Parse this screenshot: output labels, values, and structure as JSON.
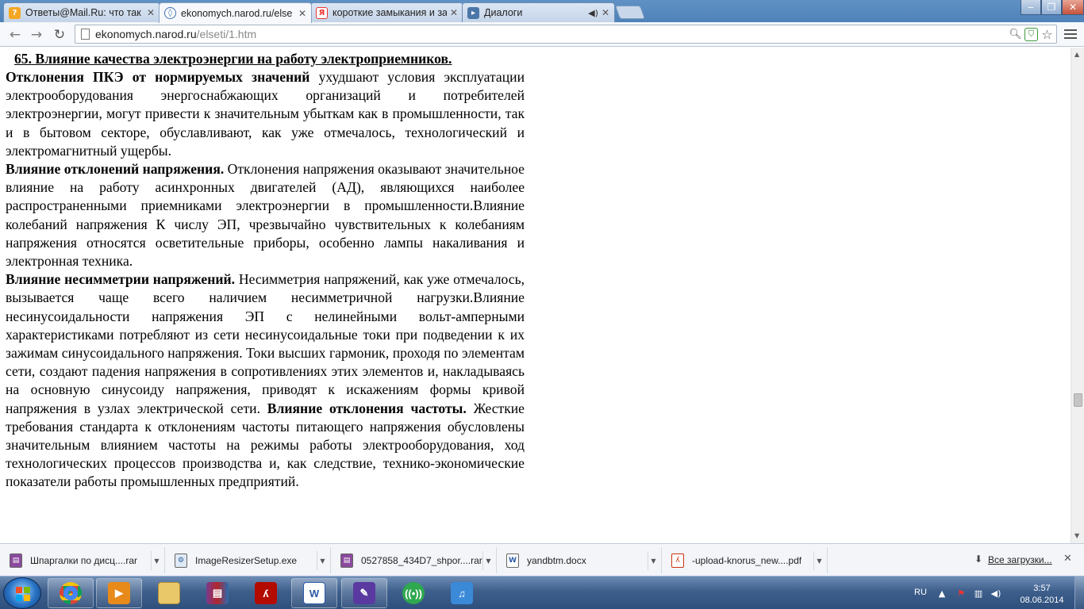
{
  "browser": {
    "tabs": [
      {
        "title": "Ответы@Mail.Ru: что так",
        "icon": "mail-ru-answers-icon"
      },
      {
        "title": "ekonomych.narod.ru/else",
        "icon": "narod-icon"
      },
      {
        "title": "короткие замыкания и за",
        "icon": "yandex-icon"
      },
      {
        "title": "Диалоги",
        "icon": "dialogs-icon"
      }
    ],
    "url_host": "ekonomych.narod.ru",
    "url_path": "/elseti/1.htm"
  },
  "article": {
    "heading": "65. Влияние качества электроэнергии на работу электроприемников.",
    "p1_bold": "Отклонения ПКЭ от нормируемых значений",
    "p1_text": " ухудшают условия эксплуатации электрооборудования энергоснабжающих организаций и потребителей электроэнергии, могут привести к значительным убыткам как в промышленности, так и в бытовом секторе, обуславливают, как уже отмечалось, технологический и электромагнитный ущербы.",
    "p2_bold": "Влияние отклонений напряжения.",
    "p2_text": " Отклонения напряжения оказывают значительное влияние на работу асинхронных двигателей (АД), являющихся наиболее распространенными приемниками электроэнергии в промышленности.Влияние колебаний напряжения К числу ЭП, чрезвычайно чувствительных к колебаниям напряжения относятся осветительные приборы, особенно лампы накаливания и электронная техника.",
    "p3_bold": "Влияние несимметрии напряжений.",
    "p3_text": " Несимметрия напряжений, как уже отмечалось, вызывается чаще всего наличием несимметричной нагрузки.Влияние несинусоидальности напряжения ЭП с нелинейными вольт-амперными характеристиками потребляют из сети несинусоидальные токи при подведении к их зажимам синусоидального напряжения. Токи высших гармоник, проходя по элементам сети, создают падения напряжения в сопротивлениях этих элементов и, накладываясь на основную синусоиду напряжения, приводят к искажениям формы кривой напряжения в узлах электрической сети.",
    "p3_bold2": " Влияние отклонения частоты.",
    "p3_text2": " Жесткие требования стандарта к отклонениям частоты питающего напряжения обусловлены значительным влиянием частоты на режимы работы электрооборудования, ход технологических процессов производства и, как следствие, технико-экономические показатели работы промышленных предприятий."
  },
  "downloads": {
    "items": [
      {
        "name": "Шпаргалки по дисц....rar",
        "icon": "winrar-archive-icon"
      },
      {
        "name": "ImageResizerSetup.exe",
        "icon": "installer-icon"
      },
      {
        "name": "0527858_434D7_shpor....rar",
        "icon": "winrar-archive-icon"
      },
      {
        "name": "yandbtm.docx",
        "icon": "word-document-icon"
      },
      {
        "name": "-upload-knorus_new....pdf",
        "icon": "pdf-icon"
      }
    ],
    "all_label": "Все загрузки..."
  },
  "taskbar": {
    "language": "RU",
    "time": "3:57",
    "date": "08.06.2014",
    "pinned": [
      "chrome-icon",
      "media-player-icon",
      "explorer-icon",
      "winrar-icon",
      "acrobat-icon",
      "word-icon",
      "pen-tool-icon",
      "network-app-icon",
      "music-app-icon"
    ]
  },
  "colors": {
    "titlebar": "#5a8cc1",
    "taskbar": "#3e5f8c",
    "link_text": "#000000"
  }
}
